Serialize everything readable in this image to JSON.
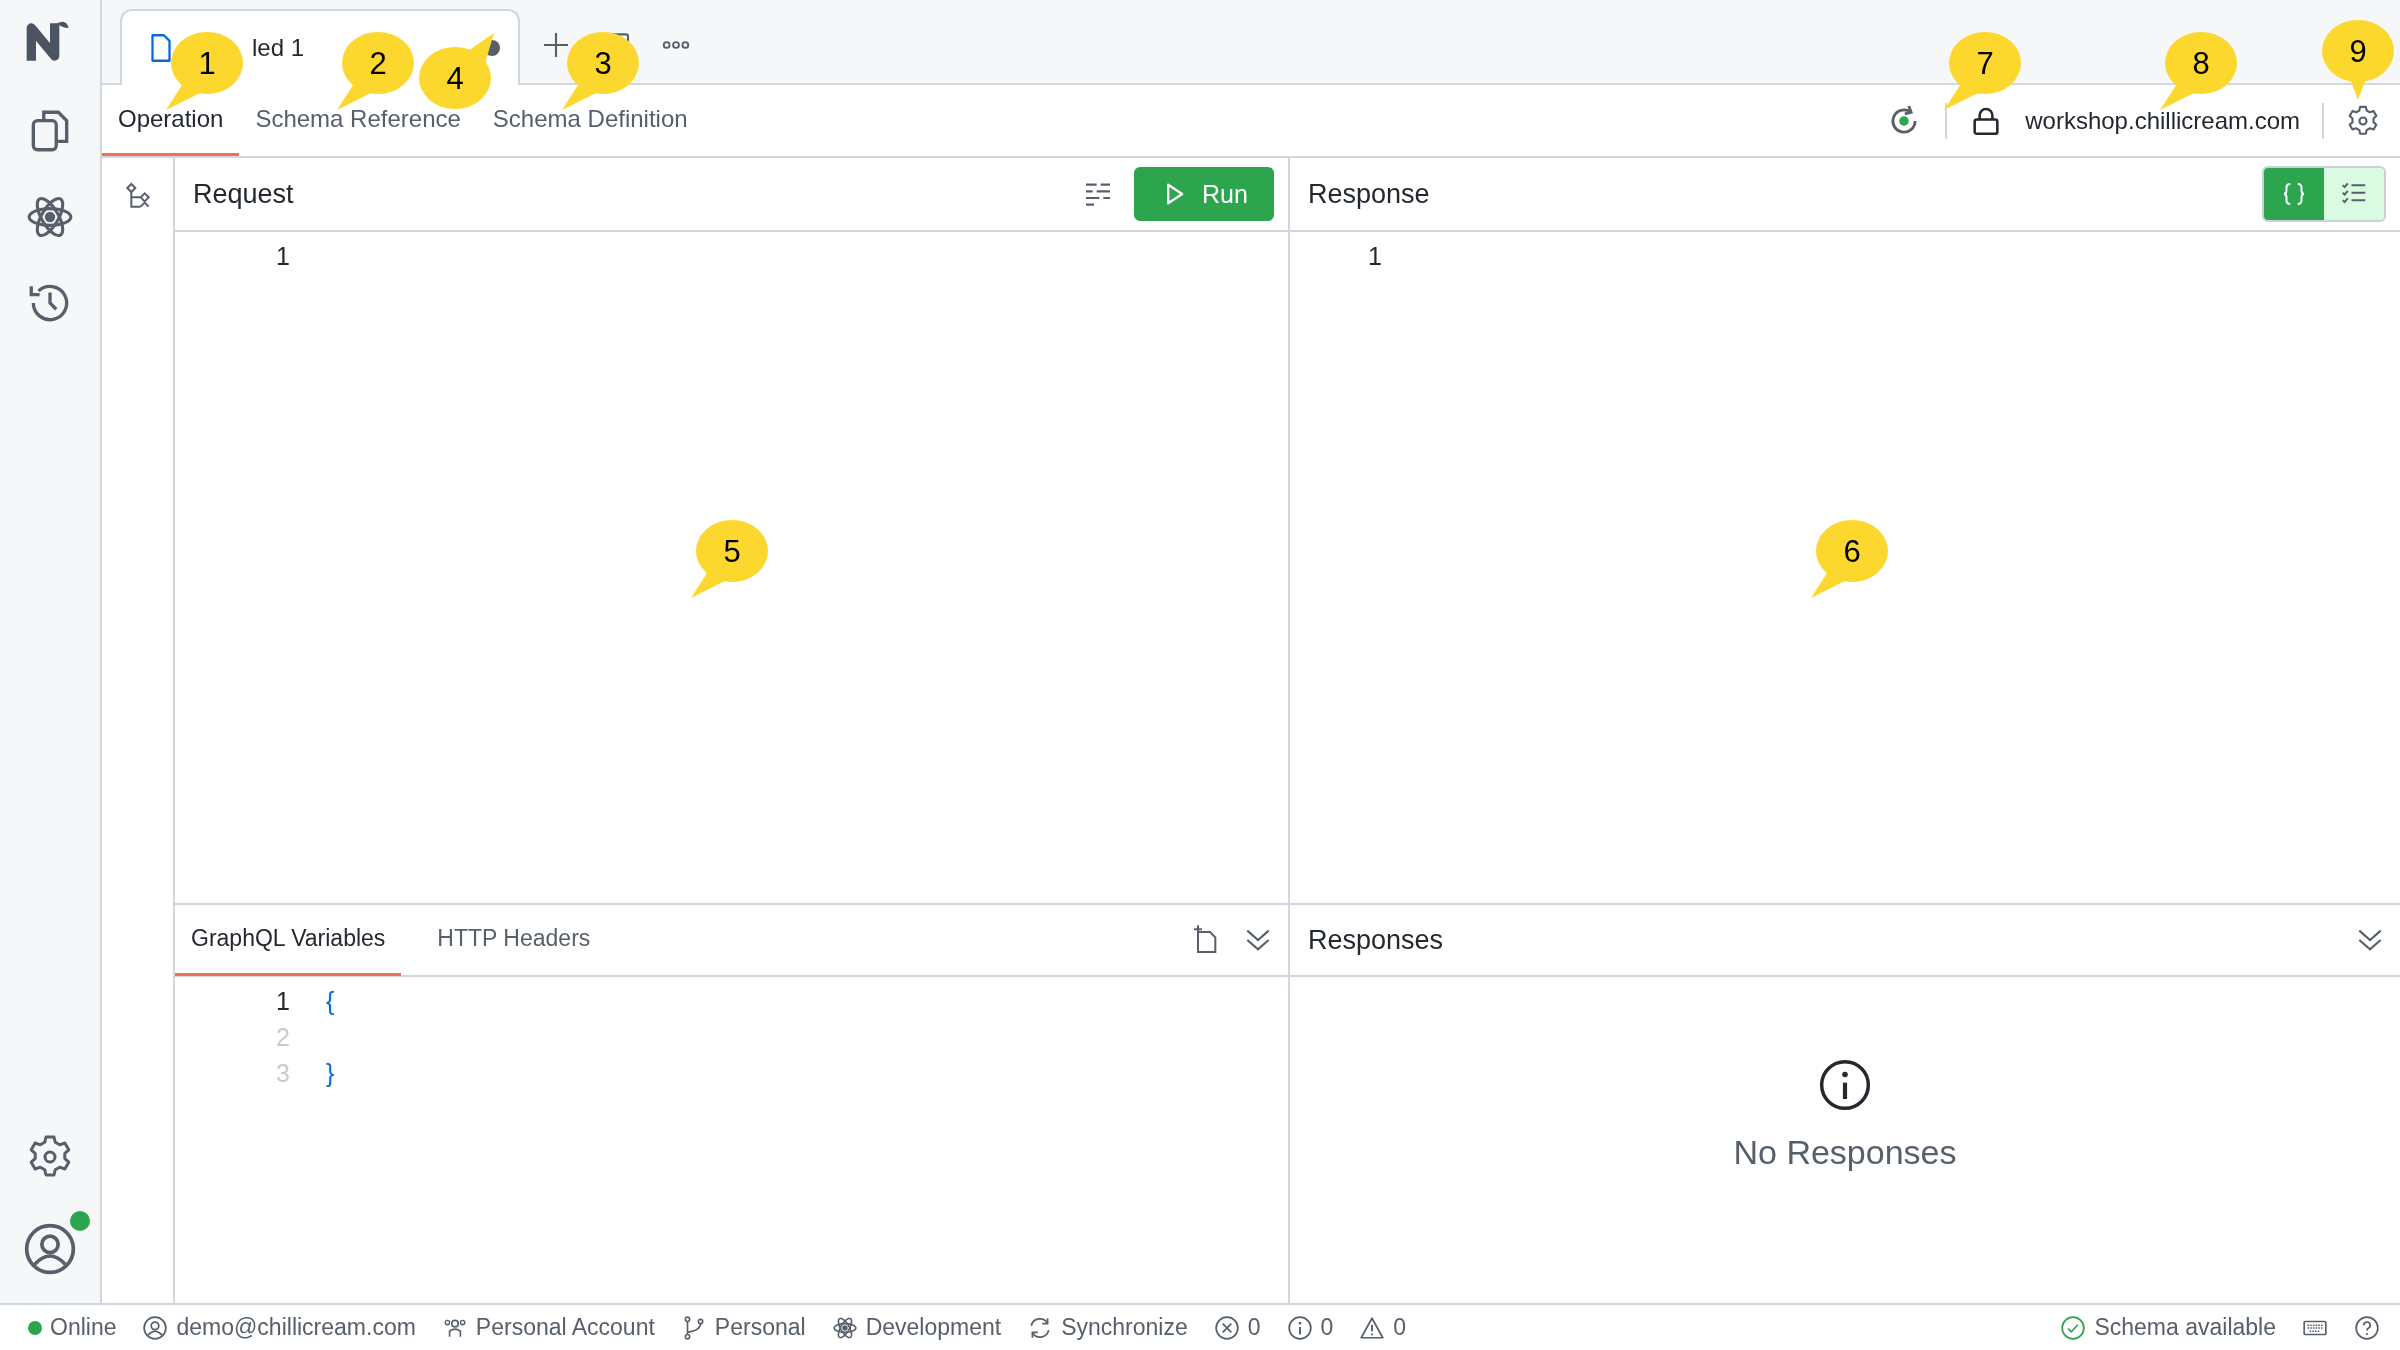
{
  "account": {
    "online": true
  },
  "document_tabs": [
    {
      "title": "led 1",
      "unsaved": true
    }
  ],
  "editor_tabs": [
    {
      "label": "Operation",
      "selected": true
    },
    {
      "label": "Schema Reference",
      "selected": false
    },
    {
      "label": "Schema Definition",
      "selected": false
    }
  ],
  "connection": {
    "connected": true,
    "url": "workshop.chillicream.com"
  },
  "request": {
    "title": "Request",
    "run_label": "Run",
    "line_numbers": [
      "1"
    ]
  },
  "response": {
    "title": "Response",
    "line_numbers": [
      "1"
    ],
    "view_modes": [
      {
        "kind": "json",
        "selected": true
      },
      {
        "kind": "list",
        "selected": false
      }
    ]
  },
  "variables": {
    "tabs": [
      {
        "label": "GraphQL Variables",
        "selected": true
      },
      {
        "label": "HTTP Headers",
        "selected": false
      }
    ],
    "lines": [
      {
        "number": "1",
        "text": "{",
        "active": true
      },
      {
        "number": "2",
        "active": false
      },
      {
        "number": "3",
        "text": "}",
        "active": false
      }
    ]
  },
  "responses": {
    "title": "Responses",
    "empty_message": "No Responses"
  },
  "status_bar": {
    "online": true,
    "online_label": "Online",
    "items": [
      {
        "kind": "user",
        "label": "demo@chillicream.com"
      },
      {
        "kind": "account",
        "label": "Personal Account"
      },
      {
        "kind": "branch",
        "label": "Personal"
      },
      {
        "kind": "environment",
        "label": "Development"
      },
      {
        "kind": "sync",
        "label": "Synchronize"
      },
      {
        "kind": "errors",
        "label": "0"
      },
      {
        "kind": "info",
        "label": "0"
      },
      {
        "kind": "warnings",
        "label": "0"
      }
    ],
    "schema_status": "Schema available"
  },
  "callouts": [
    {
      "number": "1",
      "kind": "southwest"
    },
    {
      "number": "2",
      "kind": "southwest"
    },
    {
      "number": "4",
      "kind": "northeast"
    },
    {
      "number": "3",
      "kind": "southwest"
    },
    {
      "number": "5",
      "kind": "southwest"
    },
    {
      "number": "6",
      "kind": "southwest"
    },
    {
      "number": "7",
      "kind": "southwest"
    },
    {
      "number": "8",
      "kind": "southwest"
    },
    {
      "number": "9",
      "kind": "south"
    }
  ]
}
